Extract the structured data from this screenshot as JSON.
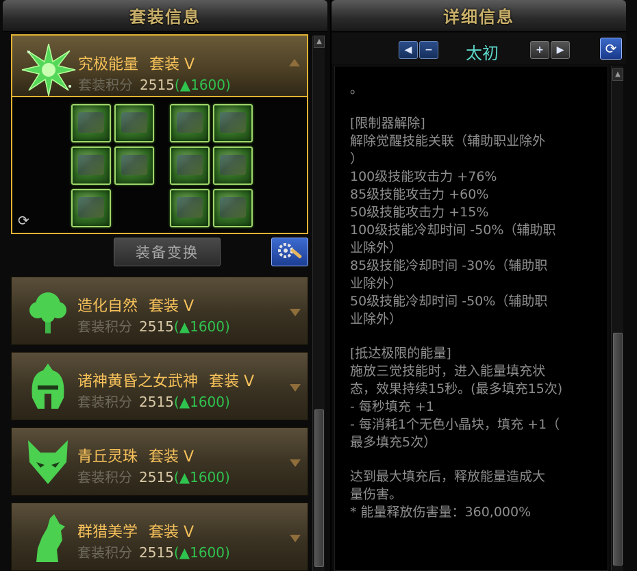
{
  "left_panel": {
    "title": "套装信息",
    "sets": [
      {
        "name": "究极能量",
        "tier": "套装 V",
        "score_label": "套装积分",
        "score": "2515",
        "bonus": "(▲1600)",
        "icon": "green-starburst-icon",
        "expanded": true
      },
      {
        "name": "造化自然",
        "tier": "套装 V",
        "score_label": "套装积分",
        "score": "2515",
        "bonus": "(▲1600)",
        "icon": "tree-icon",
        "expanded": false
      },
      {
        "name": "诸神黄昏之女武神",
        "tier": "套装 V",
        "score_label": "套装积分",
        "score": "2515",
        "bonus": "(▲1600)",
        "icon": "helmet-icon",
        "expanded": false
      },
      {
        "name": "青丘灵珠",
        "tier": "套装 V",
        "score_label": "套装积分",
        "score": "2515",
        "bonus": "(▲1600)",
        "icon": "fox-icon",
        "expanded": false
      },
      {
        "name": "群猎美学",
        "tier": "套装 V",
        "score_label": "套装积分",
        "score": "2515",
        "bonus": "(▲1600)",
        "icon": "wolf-icon",
        "expanded": false
      }
    ],
    "equip_switch_label": "装备变换",
    "refresh_icon": "refresh-icon",
    "settings_icon": "wrench-gear-icon"
  },
  "right_panel": {
    "title": "详细信息",
    "selector_label": "太初",
    "detail_lines": [
      "。",
      "",
      "[限制器解除]",
      "解除觉醒技能关联（辅助职业除外",
      "）",
      "100级技能攻击力 +76%",
      "85级技能攻击力 +60%",
      "50级技能攻击力 +15%",
      "100级技能冷却时间 -50%（辅助职",
      "业除外）",
      "85级技能冷却时间 -30%（辅助职",
      "业除外）",
      "50级技能冷却时间 -50%（辅助职",
      "业除外）",
      "",
      "[抵达极限的能量]",
      "施放三觉技能时，进入能量填充状",
      "态，效果持续15秒。(最多填充15次)",
      "- 每秒填充 +1",
      "- 每消耗1个无色小晶块，填充 +1（",
      "最多填充5次）",
      "",
      "达到最大填充后，释放能量造成大",
      "量伤害。",
      "* 能量释放伤害量：360,000%"
    ]
  },
  "colors": {
    "gold_text": "#f6c15a",
    "gold_border": "#e1b332",
    "bonus_green": "#2fc34f",
    "selector_cyan": "#5cd8c8",
    "detail_gray": "#8e8e8e"
  }
}
